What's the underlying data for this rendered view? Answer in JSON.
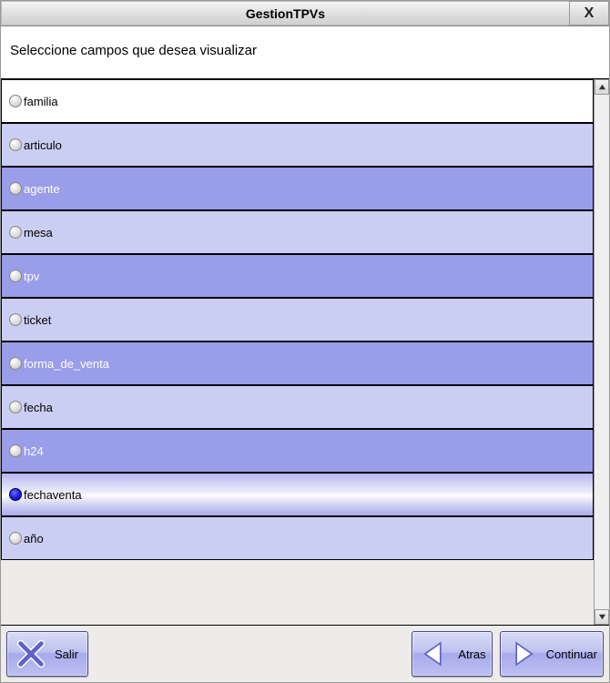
{
  "title": "GestionTPVs",
  "close_label": "X",
  "prompt": "Seleccione campos que desea visualizar",
  "fields": [
    {
      "label": "familia",
      "selected": false,
      "style": "row-0"
    },
    {
      "label": "articulo",
      "selected": false,
      "style": "row-light"
    },
    {
      "label": "agente",
      "selected": false,
      "style": "row-dark"
    },
    {
      "label": "mesa",
      "selected": false,
      "style": "row-light"
    },
    {
      "label": "tpv",
      "selected": false,
      "style": "row-dark"
    },
    {
      "label": "ticket",
      "selected": false,
      "style": "row-light"
    },
    {
      "label": "forma_de_venta",
      "selected": false,
      "style": "row-dark"
    },
    {
      "label": "fecha",
      "selected": false,
      "style": "row-light"
    },
    {
      "label": "h24",
      "selected": false,
      "style": "row-dark"
    },
    {
      "label": "fechaventa",
      "selected": true,
      "style": "row-sel"
    },
    {
      "label": "año",
      "selected": false,
      "style": "row-light"
    }
  ],
  "buttons": {
    "salir": "Salir",
    "atras": "Atras",
    "continuar": "Continuar"
  }
}
